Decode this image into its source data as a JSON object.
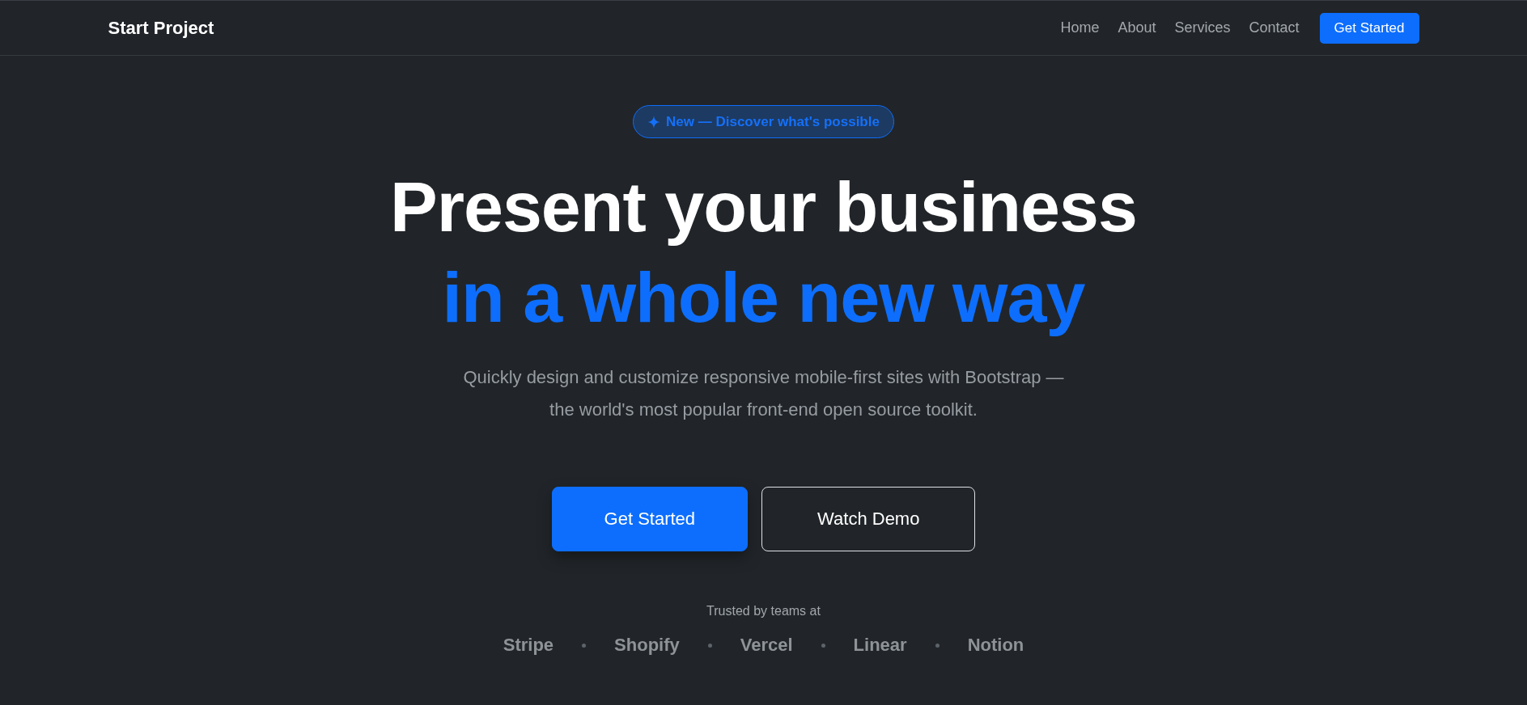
{
  "navbar": {
    "brand": "Start Project",
    "links": [
      "Home",
      "About",
      "Services",
      "Contact"
    ],
    "cta": "Get Started"
  },
  "hero": {
    "badge": "New — Discover what's possible",
    "heading": "Present your business",
    "heading_highlight": "in a whole new way",
    "subtitle": "Quickly design and customize responsive mobile-first sites with Bootstrap — the world's most popular front-end open source toolkit.",
    "buttons": [
      {
        "label": "Get Started",
        "kind": "primary"
      },
      {
        "label": "Watch Demo",
        "kind": "outline"
      }
    ]
  },
  "trusted": {
    "caption": "Trusted by teams at",
    "logos": [
      "Stripe",
      "Shopify",
      "Vercel",
      "Linear",
      "Notion"
    ]
  }
}
